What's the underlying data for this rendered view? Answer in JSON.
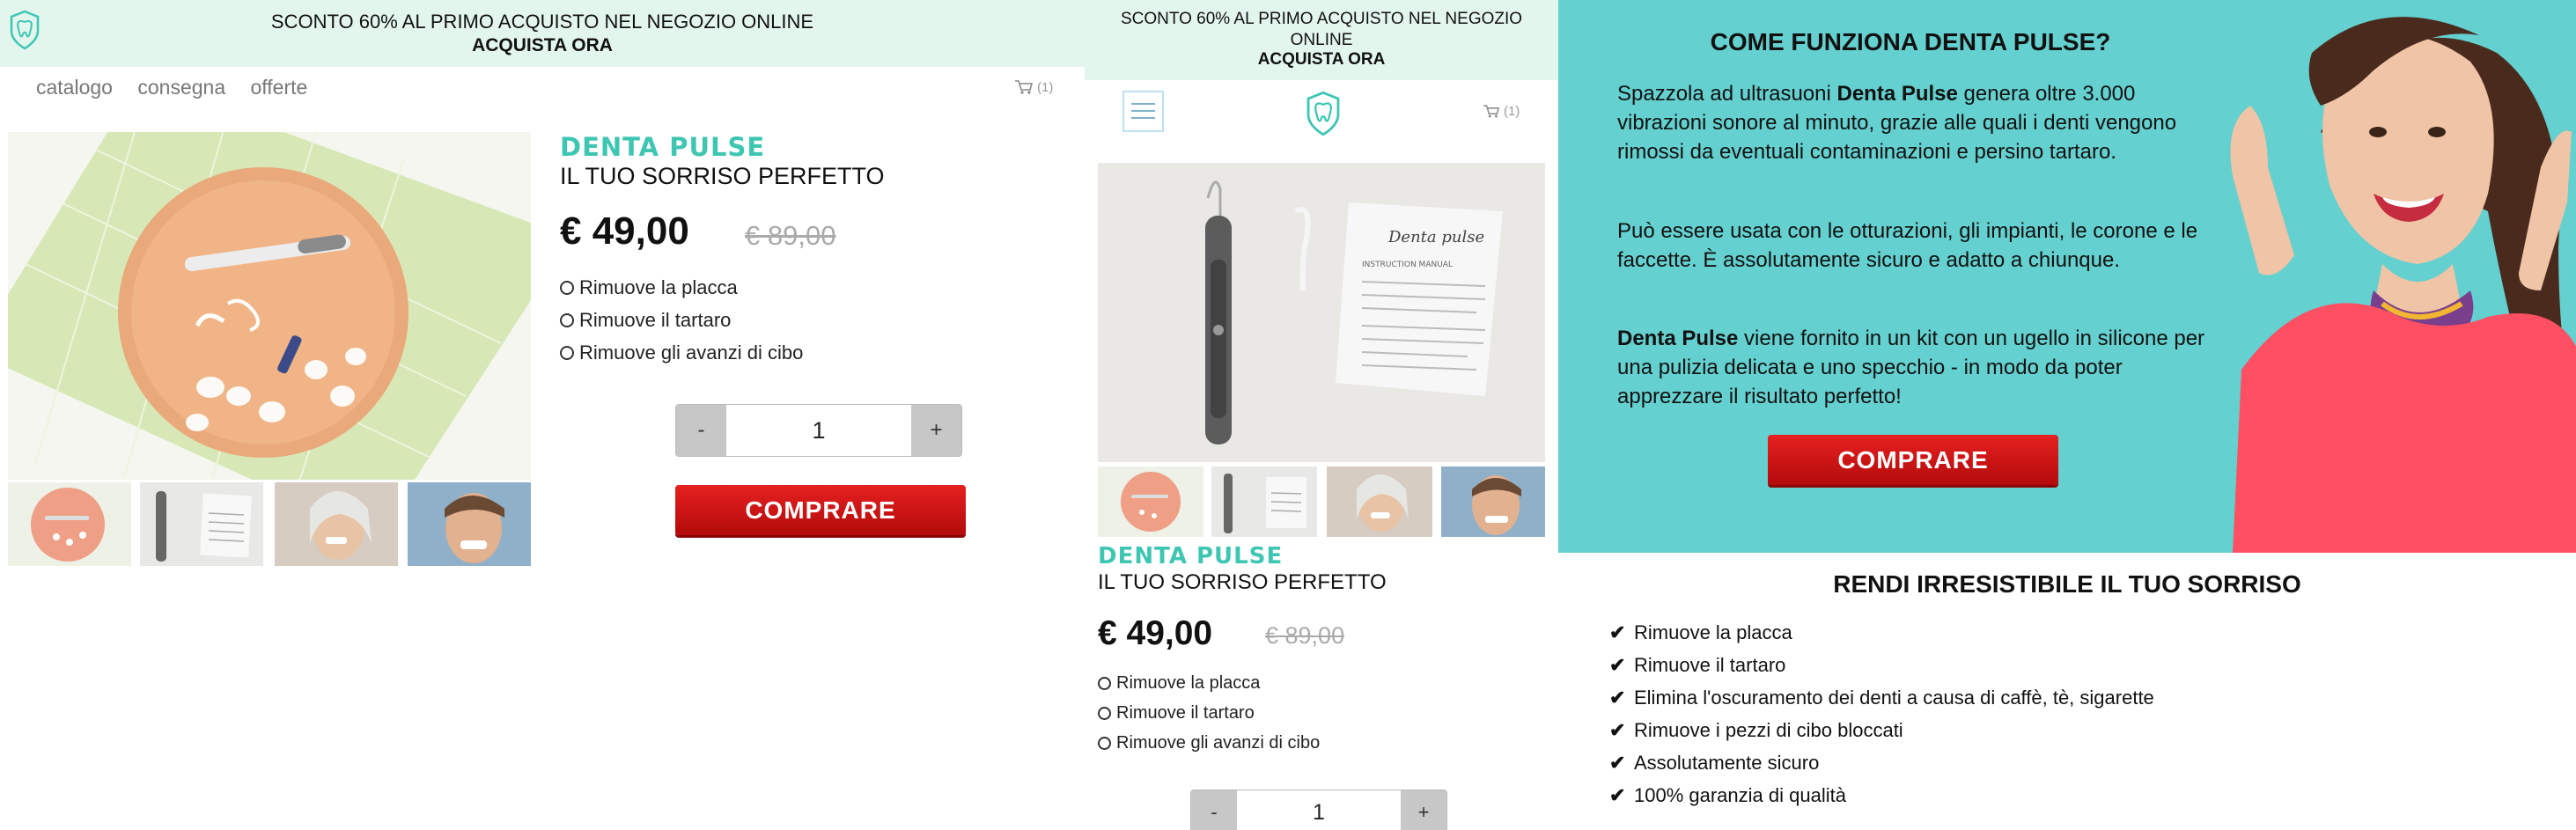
{
  "banner": {
    "line1": "SCONTO 60% AL PRIMO ACQUISTO NEL NEGOZIO ONLINE",
    "line2": "ACQUISTA ORA"
  },
  "nav": {
    "items": [
      "catalogo",
      "consegna",
      "offerte"
    ]
  },
  "cart": {
    "count": "(1)"
  },
  "product": {
    "brand": "DENTA PULSE",
    "tagline": "IL TUO SORRISO PERFETTO",
    "price": "€ 49,00",
    "old_price": "€ 89,00",
    "features": [
      "Rimuove la placca",
      "Rimuove il tartaro",
      "Rimuove gli avanzi di cibo"
    ],
    "qty": {
      "minus": "-",
      "value": "1",
      "plus": "+"
    },
    "buy_label": "COMPRARE",
    "manual_text": "Denta pulse",
    "manual_sub": "INSTRUCTION MANUAL"
  },
  "howto": {
    "title": "COME FUNZIONA DENTA PULSE?",
    "p1_pre": "Spazzola ad ultrasuoni ",
    "p1_bold": "Denta Pulse",
    "p1_post": " genera oltre 3.000 vibrazioni sonore al minuto, grazie alle quali i denti vengono rimossi da eventuali contaminazioni e persino tartaro.",
    "p2": "Può essere usata con le otturazioni, gli impianti, le corone e le faccette. È assolutamente sicuro e adatto a chiunque.",
    "p3_bold": "Denta Pulse",
    "p3_post": " viene fornito in un kit con un ugello in silicone per una pulizia delicata e uno specchio - in modo da poter apprezzare il risultato perfetto!",
    "buy_label": "COMPRARE"
  },
  "benefits": {
    "title": "RENDI IRRESISTIBILE IL TUO SORRISO",
    "items": [
      "Rimuove la placca",
      "Rimuove il tartaro",
      "Elimina l'oscuramento dei denti a causa di caffè, tè, sigarette",
      "Rimuove i pezzi di cibo bloccati",
      "Assolutamente sicuro",
      "100% garanzia di qualità"
    ]
  },
  "colors": {
    "accent": "#3fc6b3",
    "buy": "#d31414",
    "banner_bg": "#e3f6ee",
    "hero_bg": "#64d0cf"
  }
}
